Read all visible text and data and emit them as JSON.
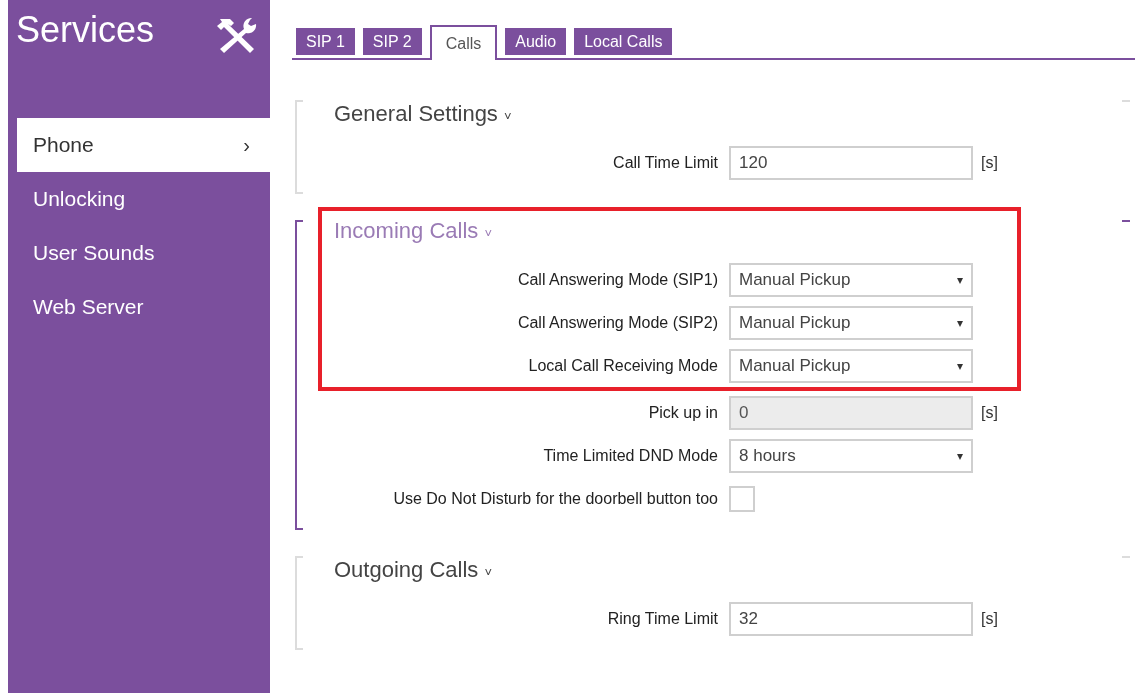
{
  "sidebar": {
    "title": "Services",
    "items": [
      {
        "label": "Phone",
        "selected": true,
        "chevron": "›"
      },
      {
        "label": "Unlocking",
        "selected": false
      },
      {
        "label": "User Sounds",
        "selected": false
      },
      {
        "label": "Web Server",
        "selected": false
      }
    ]
  },
  "tabs": [
    {
      "label": "SIP 1",
      "selected": false
    },
    {
      "label": "SIP 2",
      "selected": false
    },
    {
      "label": "Calls",
      "selected": true
    },
    {
      "label": "Audio",
      "selected": false
    },
    {
      "label": "Local Calls",
      "selected": false
    }
  ],
  "sections": [
    {
      "title": "General Settings",
      "chevron": "˅",
      "active": false,
      "fields": [
        {
          "kind": "text",
          "label": "Call Time Limit",
          "value": "120",
          "unit": "[s]",
          "disabled": false
        }
      ]
    },
    {
      "title": "Incoming Calls",
      "chevron": "˅",
      "active": true,
      "highlighted_fields": [
        {
          "kind": "select",
          "label": "Call Answering Mode (SIP1)",
          "value": "Manual Pickup",
          "arrow": "▾"
        },
        {
          "kind": "select",
          "label": "Call Answering Mode (SIP2)",
          "value": "Manual Pickup",
          "arrow": "▾"
        },
        {
          "kind": "select",
          "label": "Local Call Receiving Mode",
          "value": "Manual Pickup",
          "arrow": "▾"
        }
      ],
      "fields": [
        {
          "kind": "text",
          "label": "Pick up in",
          "value": "0",
          "unit": "[s]",
          "disabled": true
        },
        {
          "kind": "select",
          "label": "Time Limited DND Mode",
          "value": "8 hours",
          "arrow": "▾"
        },
        {
          "kind": "checkbox",
          "label": "Use Do Not Disturb for the doorbell button too",
          "checked": false
        }
      ]
    },
    {
      "title": "Outgoing Calls",
      "chevron": "˅",
      "active": false,
      "fields": [
        {
          "kind": "text",
          "label": "Ring Time Limit",
          "value": "32",
          "unit": "[s]",
          "disabled": false
        }
      ]
    }
  ]
}
